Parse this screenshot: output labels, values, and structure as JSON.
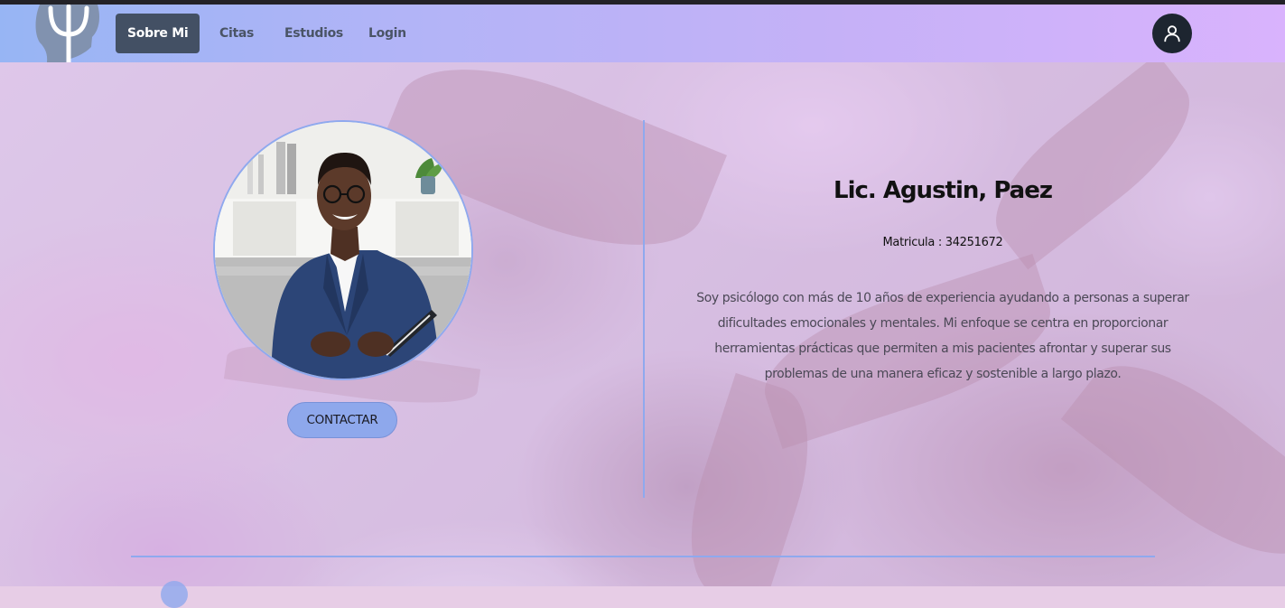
{
  "navbar": {
    "logo": {
      "icon": "psi-head-icon"
    },
    "items": [
      {
        "label": "Sobre Mi",
        "active": true
      },
      {
        "label": "Citas",
        "active": false
      },
      {
        "label": "Estudios",
        "active": false
      },
      {
        "label": "Login",
        "active": false
      }
    ],
    "profile": {
      "icon": "user-icon"
    }
  },
  "profile": {
    "name": "Lic. Agustin, Paez",
    "matricula": "Matricula : 34251672",
    "bio": "Soy psicólogo con más de 10 años de experiencia ayudando a personas a superar dificultades emocionales y mentales. Mi enfoque se centra en proporcionar herramientas prácticas que permiten a mis pacientes afrontar y superar sus problemas de una manera eficaz y sostenible a largo plazo.",
    "contact_label": "CONTACTAR"
  },
  "colors": {
    "accent": "#8ea8ec",
    "nav_active_bg": "#435064",
    "profile_button": "#1d2530"
  }
}
